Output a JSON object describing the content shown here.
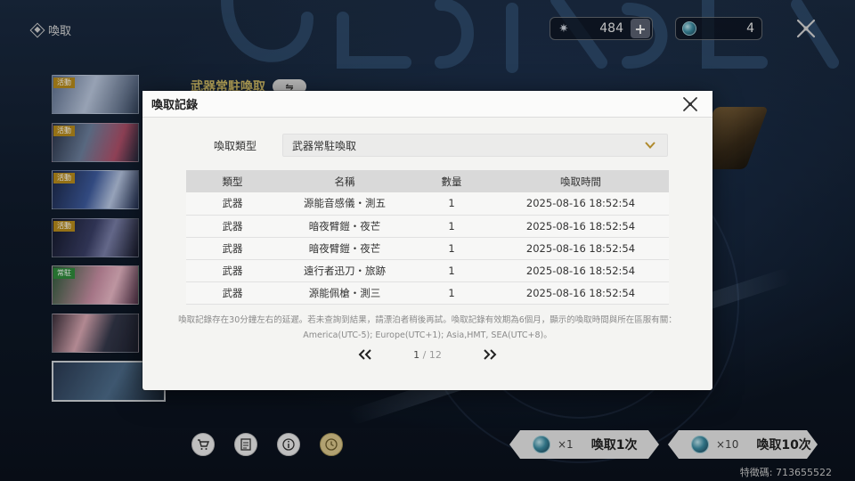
{
  "topbar": {
    "title": "喚取",
    "currency_star": {
      "icon": "star-currency-icon",
      "value": "484",
      "plus": "+"
    },
    "currency_gem": {
      "icon": "gem-currency-icon",
      "value": "4"
    }
  },
  "sidebar": {
    "banners": [
      {
        "tag": "活動",
        "tag_color": "#b68a1c"
      },
      {
        "tag": "活動",
        "tag_color": "#b68a1c"
      },
      {
        "tag": "活動",
        "tag_color": "#b68a1c"
      },
      {
        "tag": "活動",
        "tag_color": "#b68a1c"
      },
      {
        "tag": "常駐",
        "tag_color": "#2f8a3b"
      },
      {
        "tag": "",
        "tag_color": ""
      },
      {
        "tag": "",
        "tag_color": ""
      }
    ]
  },
  "section": {
    "title": "武器常駐喚取",
    "swap_icon": "swap-arrows-icon"
  },
  "dialog": {
    "title": "喚取記錄",
    "filter_label": "喚取類型",
    "filter_value": "武器常駐喚取",
    "columns": [
      "類型",
      "名稱",
      "數量",
      "喚取時間"
    ],
    "rows": [
      [
        "武器",
        "源能音感儀・測五",
        "1",
        "2025-08-16 18:52:54"
      ],
      [
        "武器",
        "暗夜臂鎧・夜芒",
        "1",
        "2025-08-16 18:52:54"
      ],
      [
        "武器",
        "暗夜臂鎧・夜芒",
        "1",
        "2025-08-16 18:52:54"
      ],
      [
        "武器",
        "遠行者迅刀・旅跡",
        "1",
        "2025-08-16 18:52:54"
      ],
      [
        "武器",
        "源能佩槍・測三",
        "1",
        "2025-08-16 18:52:54"
      ]
    ],
    "notice_line1": "喚取記錄存在30分鐘左右的延遲。若未查詢到結果，請漂泊者稍後再試。喚取記錄有效期為6個月，顯示的喚取時間與所在區服有關：",
    "notice_line2": "America(UTC-5); Europe(UTC+1); Asia,HMT, SEA(UTC+8)。",
    "pager": {
      "current": "1",
      "separator": " / ",
      "total": "12"
    }
  },
  "bottom": {
    "tools": [
      "shop-cart-icon",
      "details-list-icon",
      "info-icon",
      "history-icon"
    ],
    "pull_one": {
      "mult": "×1",
      "label": "喚取1次"
    },
    "pull_ten": {
      "mult": "×10",
      "label": "喚取10次"
    },
    "uid": "特徵碼: 713655522"
  },
  "colors": {
    "accent_gold": "#d9c46a",
    "dialog_bg": "#f4f4f2",
    "table_header": "#d9d9d9"
  }
}
